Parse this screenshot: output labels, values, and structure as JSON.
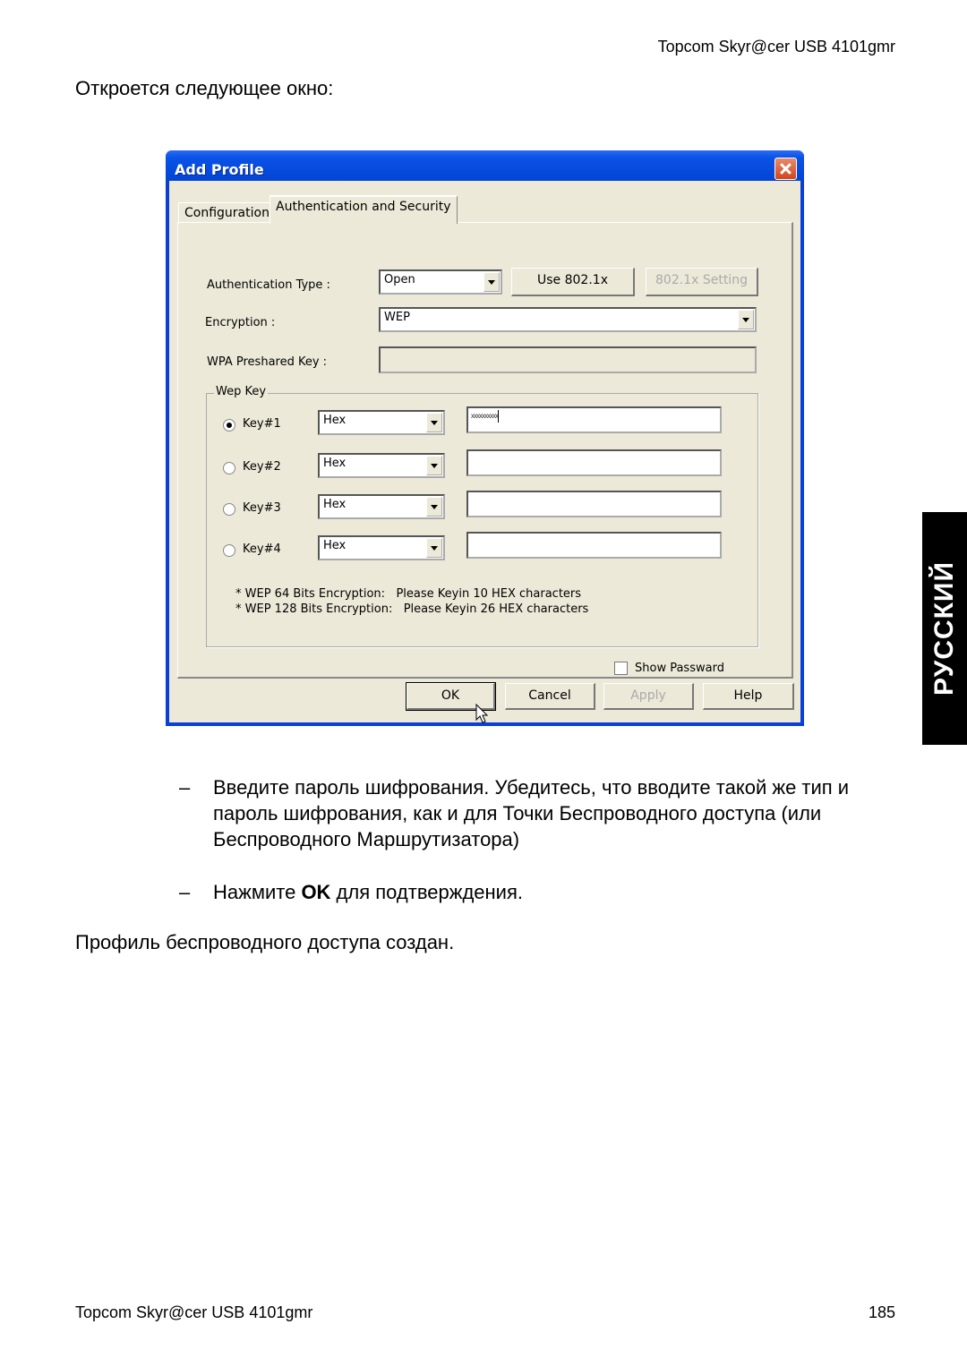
{
  "header": {
    "product": "Topcom Skyr@cer USB 4101gmr"
  },
  "intro": "Откроется следующее окно:",
  "side_tab": "РУССКИЙ",
  "dialog": {
    "title": "Add Profile",
    "tabs": [
      {
        "label": "Configuration",
        "active": false
      },
      {
        "label": "Authentication and Security",
        "active": true
      }
    ],
    "auth_type": {
      "label": "Authentication Type :",
      "value": "Open"
    },
    "use_8021x_button": "Use 802.1x",
    "setting_8021x_button": "802.1x Setting",
    "encryption": {
      "label": "Encryption :",
      "value": "WEP"
    },
    "wpa_psk": {
      "label": "WPA Preshared Key :",
      "value": ""
    },
    "wep_key_group": {
      "legend": "Wep Key",
      "keys": [
        {
          "label": "Key#1",
          "selected": true,
          "format": "Hex",
          "value": "xxxxxxxxxx"
        },
        {
          "label": "Key#2",
          "selected": false,
          "format": "Hex",
          "value": ""
        },
        {
          "label": "Key#3",
          "selected": false,
          "format": "Hex",
          "value": ""
        },
        {
          "label": "Key#4",
          "selected": false,
          "format": "Hex",
          "value": ""
        }
      ],
      "note_64": "* WEP 64 Bits Encryption:   Please Keyin 10 HEX characters",
      "note_128": "* WEP 128 Bits Encryption:   Please Keyin 26 HEX characters"
    },
    "show_password": {
      "label": "Show Passward",
      "checked": false
    },
    "buttons": {
      "ok": "OK",
      "cancel": "Cancel",
      "apply": "Apply",
      "help": "Help"
    }
  },
  "bullets": [
    {
      "dash": "–",
      "text": "Введите пароль шифрования. Убедитесь, что вводите такой же тип и пароль шифрования, как и для Точки Беспроводного доступа (или Беспроводного Маршрутизатора)"
    },
    {
      "dash": "–",
      "pre": "Нажмите ",
      "bold": "OK",
      "post": " для подтверждения."
    }
  ],
  "outro": "Профиль беспроводного доступа создан.",
  "footer": {
    "product": "Topcom Skyr@cer USB 4101gmr",
    "page": "185"
  }
}
